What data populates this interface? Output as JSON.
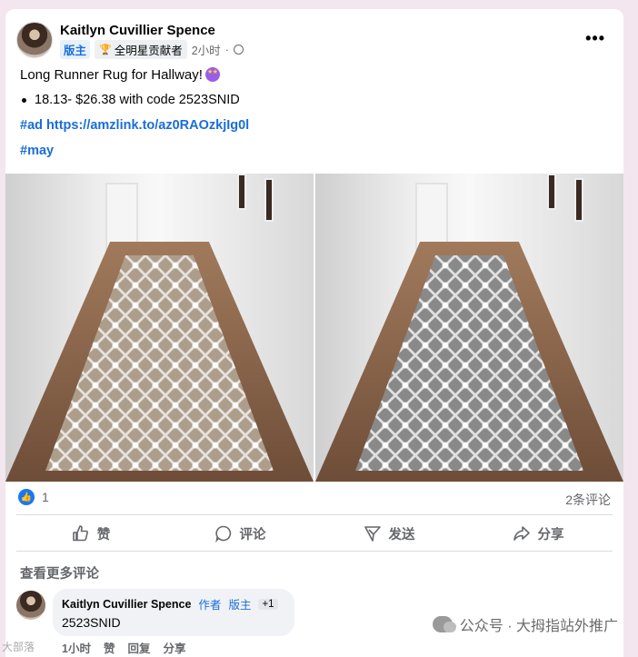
{
  "post": {
    "author": "Kaitlyn Cuvillier Spence",
    "badge_admin": "版主",
    "badge_star": "全明星贡献者",
    "time": "2小时",
    "time_separator": "·",
    "more_icon": "ellipsis-icon",
    "title": "Long Runner Rug for Hallway!",
    "bullet": "18.13- $26.38 with code 2523SNID",
    "ad_tag": "#ad",
    "link": "https://amzlink.to/az0RAOzkjIg0l",
    "tag2": "#may"
  },
  "reactions": {
    "like_count": "1",
    "comment_count": "2条评论"
  },
  "actions": {
    "like": "赞",
    "comment": "评论",
    "send": "发送",
    "share": "分享"
  },
  "comments": {
    "view_more": "查看更多评论",
    "item": {
      "author": "Kaitlyn Cuvillier Spence",
      "role_author": "作者",
      "role_admin": "版主",
      "plus": "+1",
      "text": "2523SNID",
      "time": "1小时",
      "like": "赞",
      "reply": "回复",
      "share": "分享"
    }
  },
  "watermark": {
    "text": "公众号 · 大拇指站外推广",
    "corner": "大部落"
  },
  "colors": {
    "accent": "#1a6ed8",
    "like_blue": "#1877f2",
    "background": "#f3e6ee"
  }
}
